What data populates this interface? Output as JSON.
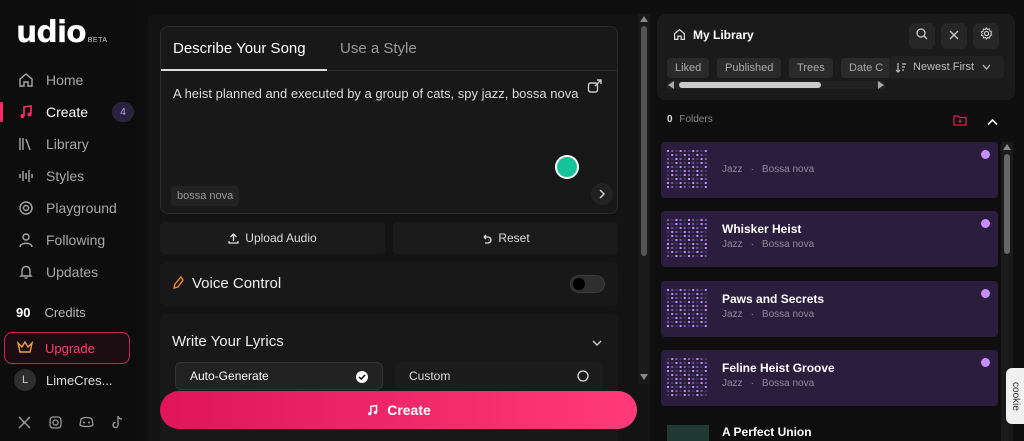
{
  "brand": {
    "logo": "udio",
    "beta": "BETA"
  },
  "nav": {
    "home": "Home",
    "create": "Create",
    "create_badge": "4",
    "library": "Library",
    "styles": "Styles",
    "playground": "Playground",
    "following": "Following",
    "updates": "Updates"
  },
  "credits": {
    "count": "90",
    "label": "Credits"
  },
  "upgrade": {
    "label": "Upgrade"
  },
  "user": {
    "initial": "L",
    "name": "LimeCres..."
  },
  "composer": {
    "tab_describe": "Describe Your Song",
    "tab_style": "Use a Style",
    "prompt": "A heist planned and executed by a group of cats, spy jazz, bossa nova",
    "tag": "bossa nova",
    "upload_label": "Upload Audio",
    "reset_label": "Reset",
    "voice_label": "Voice Control",
    "lyrics_label": "Write Your Lyrics",
    "opt_auto": "Auto-Generate",
    "opt_custom": "Custom",
    "create_label": "Create"
  },
  "library": {
    "title": "My Library",
    "chips": [
      "Liked",
      "Published",
      "Trees",
      "Date C"
    ],
    "sort_label": "Newest First",
    "folders_count": "0",
    "folders_label": "Folders",
    "songs": [
      {
        "title": "",
        "genre": "Jazz",
        "style": "Bossa nova"
      },
      {
        "title": "Whisker Heist",
        "genre": "Jazz",
        "style": "Bossa nova"
      },
      {
        "title": "Paws and Secrets",
        "genre": "Jazz",
        "style": "Bossa nova"
      },
      {
        "title": "Feline Heist Groove",
        "genre": "Jazz",
        "style": "Bossa nova"
      }
    ],
    "last_song": "A Perfect Union"
  },
  "cookie": {
    "label": "cookie"
  },
  "colors": {
    "accent": "#ff2a68",
    "purple": "#c88dff",
    "row": "#2a1d3e"
  }
}
